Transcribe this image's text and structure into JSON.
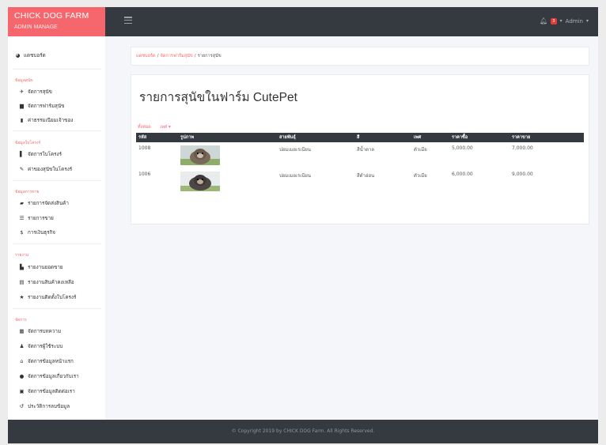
{
  "brand": {
    "title": "CHICK DOG FARM",
    "subtitle": "ADMIN MANAGE",
    "color": "#f5676d"
  },
  "navbar": {
    "bell_count": "3",
    "user_label": "Admin"
  },
  "sidebar": {
    "dashboard": "แดชบอร์ด",
    "sections": [
      {
        "title": "ข้อมูลสุนัข",
        "items": [
          "จัดการสุนัข",
          "จัดการฟาร์มสุนัข",
          "ค่าธรรมเนียมเจ้าของ"
        ]
      },
      {
        "title": "ข้อมูลใบโครงร์",
        "items": [
          "จัดการใบโครงร์",
          "ค่าของสุนัขในโครงร์"
        ]
      },
      {
        "title": "ข้อมูลการขาย",
        "items": [
          "รายการจัดส่งสินค้า",
          "รายการขาย",
          "การเงินธุรกิจ"
        ]
      },
      {
        "title": "รายงาน",
        "items": [
          "รายงานยอดขาย",
          "รายงานสินค้าคงเหลือ",
          "รายงานติดตั้งใบโครงร์"
        ]
      },
      {
        "title": "จัดการ",
        "items": [
          "จัดการบทความ",
          "จัดการผู้ใช้ระบบ",
          "จัดการข้อมูลหน้าแรก",
          "จัดการข้อมูลเกี่ยวกับเรา",
          "จัดการข้อมูลติดต่อเรา",
          "ประวัติการลบข้อมูล"
        ]
      }
    ]
  },
  "breadcrumb": {
    "home": "แดชบอร์ด",
    "parent": "จัดการฟาร์มสุนัข",
    "current": "รายการสุนัข"
  },
  "page_title": "รายการสุนัขในฟาร์ม CutePet",
  "filters": {
    "all": "ทั้งหมด",
    "sex": "เพศ ▾"
  },
  "table": {
    "headers": [
      "รหัส",
      "รูปภาพ",
      "สายพันธุ์",
      "สี",
      "เพศ",
      "ราคาซื้อ",
      "ราคาขาย"
    ],
    "rows": [
      {
        "id": "1008",
        "breed": "ปอมเมอเรเนียน",
        "color": "สีน้ำตาล",
        "sex": "ตัวเมีย",
        "buy": "5,000.00",
        "sell": "7,000.00"
      },
      {
        "id": "1006",
        "breed": "ปอมเมอเรเนียน",
        "color": "สีดำอ่อน",
        "sex": "ตัวเมีย",
        "buy": "6,000.00",
        "sell": "9,000.00"
      }
    ]
  },
  "footer": {
    "text": "© Copyright 2019 by CHICK DOG Farm. All Rights Reserved."
  }
}
